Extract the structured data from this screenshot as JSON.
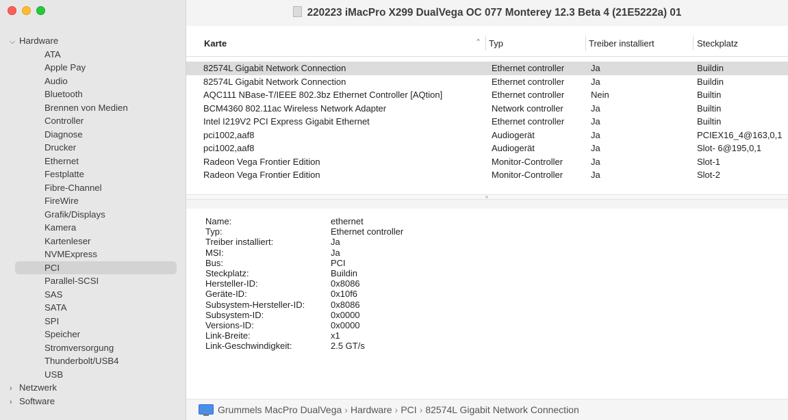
{
  "window": {
    "title": "220223 iMacPro X299 DualVega OC 077 Monterey 12.3 Beta 4 (21E5222a) 01"
  },
  "sidebar": {
    "hardware_label": "Hardware",
    "hardware_items": [
      "ATA",
      "Apple Pay",
      "Audio",
      "Bluetooth",
      "Brennen von Medien",
      "Controller",
      "Diagnose",
      "Drucker",
      "Ethernet",
      "Festplatte",
      "Fibre-Channel",
      "FireWire",
      "Grafik/Displays",
      "Kamera",
      "Kartenleser",
      "NVMExpress",
      "PCI",
      "Parallel-SCSI",
      "SAS",
      "SATA",
      "SPI",
      "Speicher",
      "Stromversorgung",
      "Thunderbolt/USB4",
      "USB"
    ],
    "selected": "PCI",
    "network_label": "Netzwerk",
    "software_label": "Software"
  },
  "table": {
    "headers": [
      "Karte",
      "Typ",
      "Treiber installiert",
      "Steckplatz"
    ],
    "rows": [
      [
        "82574L Gigabit Network Connection",
        "Ethernet controller",
        "Ja",
        "Buildin"
      ],
      [
        "82574L Gigabit Network Connection",
        "Ethernet controller",
        "Ja",
        "Buildin"
      ],
      [
        "AQC111 NBase-T/IEEE 802.3bz Ethernet Controller [AQtion]",
        "Ethernet controller",
        "Nein",
        "Builtin"
      ],
      [
        "BCM4360 802.11ac Wireless Network Adapter",
        "Network controller",
        "Ja",
        "Builtin"
      ],
      [
        "Intel I219V2 PCI Express Gigabit Ethernet",
        "Ethernet controller",
        "Ja",
        "Builtin"
      ],
      [
        "pci1002,aaf8",
        "Audiogerät",
        "Ja",
        "PCIEX16_4@163,0,1"
      ],
      [
        "pci1002,aaf8",
        "Audiogerät",
        "Ja",
        "Slot- 6@195,0,1"
      ],
      [
        "Radeon Vega Frontier Edition",
        "Monitor-Controller",
        "Ja",
        "Slot-1"
      ],
      [
        "Radeon Vega Frontier Edition",
        "Monitor-Controller",
        "Ja",
        "Slot-2"
      ]
    ]
  },
  "details": [
    [
      "Name:",
      "ethernet"
    ],
    [
      "Typ:",
      "Ethernet controller"
    ],
    [
      "Treiber installiert:",
      "Ja"
    ],
    [
      "MSI:",
      "Ja"
    ],
    [
      "Bus:",
      "PCI"
    ],
    [
      "Steckplatz:",
      "Buildin"
    ],
    [
      "Hersteller-ID:",
      "0x8086"
    ],
    [
      "Geräte-ID:",
      "0x10f6"
    ],
    [
      "Subsystem-Hersteller-ID:",
      "0x8086"
    ],
    [
      "Subsystem-ID:",
      "0x0000"
    ],
    [
      "Versions-ID:",
      "0x0000"
    ],
    [
      "Link-Breite:",
      "x1"
    ],
    [
      "Link-Geschwindigkeit:",
      "2.5 GT/s"
    ]
  ],
  "footer": {
    "path": [
      "Grummels MacPro DualVega",
      "Hardware",
      "PCI",
      "82574L Gigabit Network Connection"
    ]
  }
}
